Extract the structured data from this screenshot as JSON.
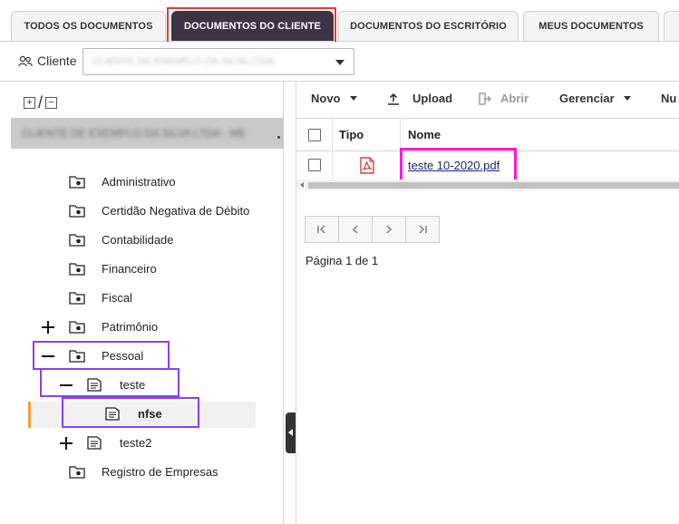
{
  "tabs": [
    {
      "label": "TODOS OS DOCUMENTOS"
    },
    {
      "label": "DOCUMENTOS DO CLIENTE"
    },
    {
      "label": "DOCUMENTOS DO ESCRITÓRIO"
    },
    {
      "label": "MEUS DOCUMENTOS"
    }
  ],
  "client": {
    "label": "Cliente",
    "selected_value": "CLIENTE DE EXEMPLO DA SILVA LTDA",
    "icon": "users-icon"
  },
  "tree": {
    "expand_all": "+",
    "separator": "/",
    "collapse_all": "−",
    "client_name": "CLIENTE DE EXEMPLO DA SILVA LTDA - ME",
    "items": [
      {
        "label": "Administrativo"
      },
      {
        "label": "Certidão Negativa de Débito"
      },
      {
        "label": "Contabilidade"
      },
      {
        "label": "Financeiro"
      },
      {
        "label": "Fiscal"
      },
      {
        "label": "Patrimônio"
      },
      {
        "label": "Pessoal"
      },
      {
        "label": "teste"
      },
      {
        "label": "nfse"
      },
      {
        "label": "teste2"
      },
      {
        "label": "Registro de Empresas"
      }
    ]
  },
  "toolbar": {
    "new_label": "Novo",
    "upload_label": "Upload",
    "open_label": "Abrir",
    "manage_label": "Gerenciar",
    "more_label": "Nu"
  },
  "grid": {
    "columns": [
      "Tipo",
      "Nome"
    ],
    "rows": [
      {
        "type": "pdf-icon",
        "name": "teste 10-2020.pdf"
      }
    ]
  },
  "pager": {
    "first": "|<",
    "prev": "<",
    "next": ">",
    "last": ">|",
    "info": "Página 1 de 1"
  },
  "colors": {
    "active_tab": "#3d3545",
    "highlight_red": "#e53935",
    "highlight_purple": "#8a3ff0",
    "highlight_magenta": "#ff19d9",
    "selected_marker": "#f0a030",
    "pdf_red": "#e53935"
  }
}
